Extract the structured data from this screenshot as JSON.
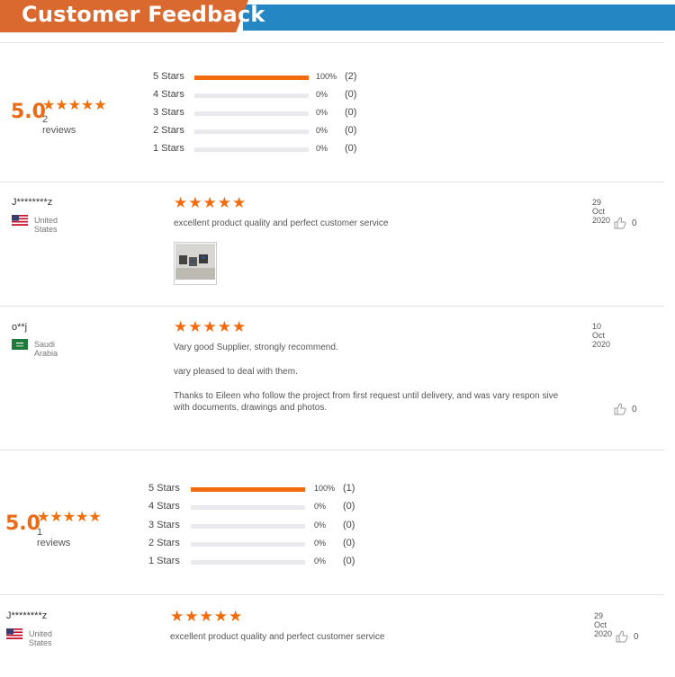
{
  "header": {
    "title": "Customer Feedback"
  },
  "summaries": [
    {
      "average": "5.0",
      "stars": "★★★★★",
      "reviews_label": "2 reviews",
      "rows": [
        {
          "label": "5 Stars",
          "fraction": 1.0,
          "pct": "100%",
          "count": "(2)"
        },
        {
          "label": "4 Stars",
          "fraction": 0.0,
          "pct": "0%",
          "count": "(0)"
        },
        {
          "label": "3 Stars",
          "fraction": 0.0,
          "pct": "0%",
          "count": "(0)"
        },
        {
          "label": "2 Stars",
          "fraction": 0.0,
          "pct": "0%",
          "count": "(0)"
        },
        {
          "label": "1 Stars",
          "fraction": 0.0,
          "pct": "0%",
          "count": "(0)"
        }
      ]
    },
    {
      "average": "5.0",
      "stars": "★★★★★",
      "reviews_label": "1 reviews",
      "rows": [
        {
          "label": "5 Stars",
          "fraction": 1.0,
          "pct": "100%",
          "count": "(1)"
        },
        {
          "label": "4 Stars",
          "fraction": 0.0,
          "pct": "0%",
          "count": "(0)"
        },
        {
          "label": "3 Stars",
          "fraction": 0.0,
          "pct": "0%",
          "count": "(0)"
        },
        {
          "label": "2 Stars",
          "fraction": 0.0,
          "pct": "0%",
          "count": "(0)"
        },
        {
          "label": "1 Stars",
          "fraction": 0.0,
          "pct": "0%",
          "count": "(0)"
        }
      ]
    }
  ],
  "reviews": [
    {
      "name": "J********z",
      "country": "United States",
      "flag": "us-flag",
      "stars": "★★★★★",
      "date": "29 Oct 2020",
      "paragraphs": [
        "excellent product quality and perfect customer service"
      ],
      "likes": "0",
      "has_photo": true
    },
    {
      "name": "o**j",
      "country": "Saudi Arabia",
      "flag": "saudi-flag",
      "stars": "★★★★★",
      "date": "10 Oct 2020",
      "paragraphs": [
        "Vary good Supplier, strongly recommend.",
        "vary pleased to deal with them.",
        "Thanks to Eileen who follow the project from first request until delivery, and was vary respon sive with documents, drawings and photos."
      ],
      "likes": "0",
      "has_photo": false
    },
    {
      "name": "J********z",
      "country": "United States",
      "flag": "us-flag",
      "stars": "★★★★★",
      "date": "29 Oct 2020",
      "paragraphs": [
        "excellent product quality and perfect customer service"
      ],
      "likes": "0",
      "has_photo": false
    }
  ],
  "colors": {
    "accent": "#f26b0f",
    "header_orange": "#d9692e",
    "header_blue": "#2487c4"
  }
}
